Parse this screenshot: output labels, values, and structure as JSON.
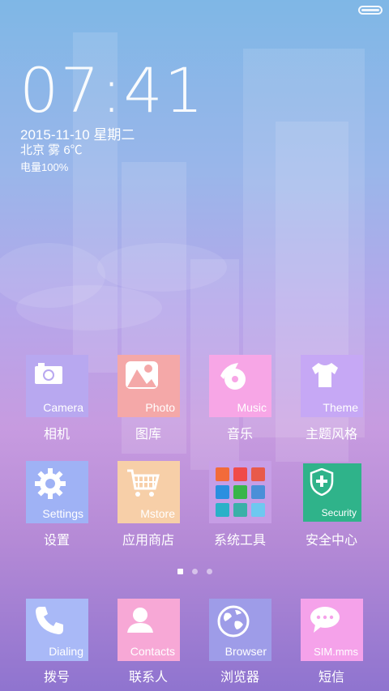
{
  "status_bar": {
    "battery_icon": "battery-icon"
  },
  "lockscreen": {
    "time": "07:41",
    "date": "2015-11-10 星期二",
    "weather": "北京 雾 6℃",
    "battery": "电量100%"
  },
  "apps_row1": [
    {
      "tile_label": "Camera",
      "name": "相机",
      "color": "#b8a8f0",
      "icon": "camera-icon"
    },
    {
      "tile_label": "Photo",
      "name": "图库",
      "color": "#f4a8a8",
      "icon": "photo-icon"
    },
    {
      "tile_label": "Music",
      "name": "音乐",
      "color": "#f7a6e6",
      "icon": "music-icon"
    },
    {
      "tile_label": "Theme",
      "name": "主题风格",
      "color": "#c6a8f5",
      "icon": "theme-shirt-icon"
    }
  ],
  "apps_row2": [
    {
      "tile_label": "Settings",
      "name": "设置",
      "color": "#9fb2f5",
      "icon": "gear-icon"
    },
    {
      "tile_label": "Mstore",
      "name": "应用商店",
      "color": "#f7cfa8",
      "icon": "cart-icon"
    },
    {
      "tile_label": "",
      "name": "系统工具",
      "color": "#c8a0e8",
      "icon": "folder-icon"
    },
    {
      "tile_label": "Security",
      "name": "安全中心",
      "color": "#2fb38a",
      "icon": "shield-icon"
    }
  ],
  "page_indicator": {
    "count": 3,
    "active_index": 0
  },
  "dock": [
    {
      "tile_label": "Dialing",
      "name": "拨号",
      "color": "#a9b9f7",
      "icon": "phone-icon"
    },
    {
      "tile_label": "Contacts",
      "name": "联系人",
      "color": "#f7a8d6",
      "icon": "contact-icon"
    },
    {
      "tile_label": "Browser",
      "name": "浏览器",
      "color": "#9e9ce8",
      "icon": "globe-icon"
    },
    {
      "tile_label": "SIM.mms",
      "name": "短信",
      "color": "#f5a2ea",
      "icon": "message-icon"
    }
  ]
}
